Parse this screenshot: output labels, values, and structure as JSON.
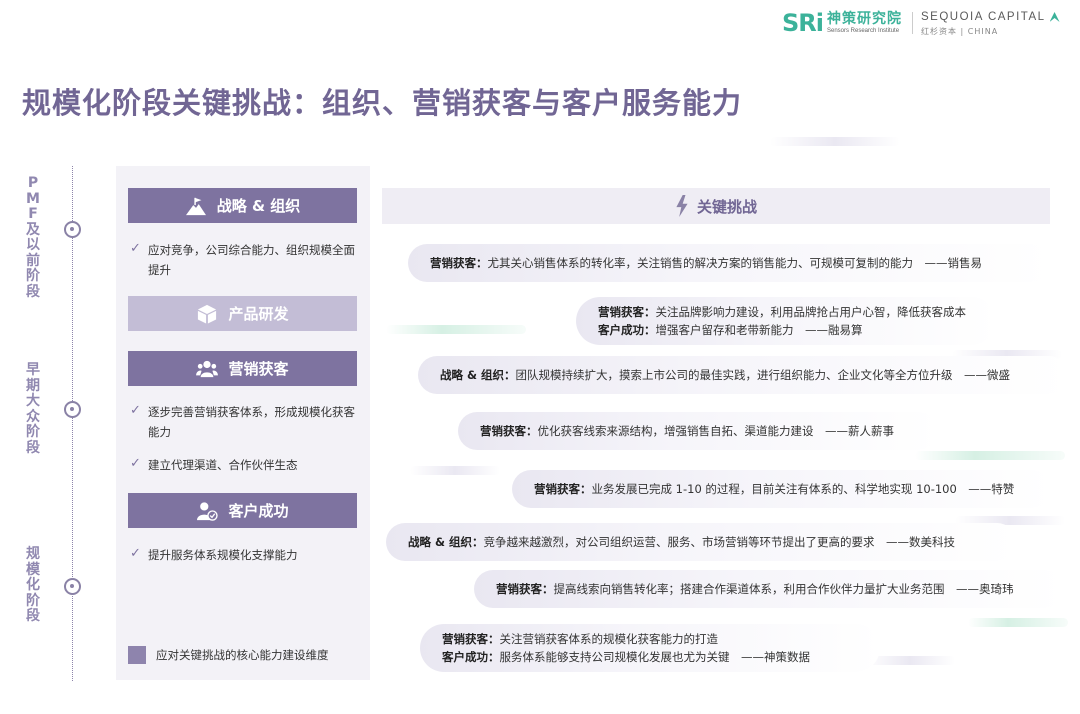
{
  "header": {
    "sri_mark": "SRi",
    "sri_name_cn": "神策研究院",
    "sri_name_en": "Sensors Research Institute",
    "sequoia_name_en": "SEQUOIA CAPITAL",
    "sequoia_name_cn": "红杉资本 | CHINA"
  },
  "title": "规模化阶段关键挑战：组织、营销获客与客户服务能力",
  "timeline": {
    "stages": [
      {
        "label": "PMF及以前阶段"
      },
      {
        "label": "早期大众阶段"
      },
      {
        "label": "规模化阶段"
      }
    ]
  },
  "capabilities": {
    "categories": [
      {
        "title": "战略 & 组织",
        "icon": "flag-mountain-icon",
        "items": [
          "应对竞争，公司综合能力、组织规模全面提升"
        ]
      },
      {
        "title": "产品研发",
        "icon": "cube-icon",
        "items": []
      },
      {
        "title": "营销获客",
        "icon": "users-icon",
        "items": [
          "逐步完善营销获客体系，形成规模化获客能力",
          "建立代理渠道、合作伙伴生态"
        ]
      },
      {
        "title": "客户成功",
        "icon": "user-check-icon",
        "items": [
          "提升服务体系规模化支撑能力"
        ]
      }
    ],
    "legend": "应对关键挑战的核心能力建设维度",
    "colors": {
      "dark": "#7e73a0",
      "light": "#c3bdd6"
    }
  },
  "challenges": {
    "header": "关键挑战",
    "icon": "lightning-icon",
    "items": [
      {
        "lines": [
          {
            "tag": "营销获客：",
            "text": "尤其关心销售体系的转化率，关注销售的解决方案的销售能力、可规模可复制的能力　——销售易"
          }
        ]
      },
      {
        "lines": [
          {
            "tag": "营销获客：",
            "text": "关注品牌影响力建设，利用品牌抢占用户心智，降低获客成本"
          },
          {
            "tag": "客户成功：",
            "text": "增强客户留存和老带新能力　——融易算"
          }
        ]
      },
      {
        "lines": [
          {
            "tag": "战略 & 组织：",
            "text": "团队规模持续扩大，摸索上市公司的最佳实践，进行组织能力、企业文化等全方位升级　——微盛"
          }
        ]
      },
      {
        "lines": [
          {
            "tag": "营销获客：",
            "text": "优化获客线索来源结构，增强销售自拓、渠道能力建设　——薪人薪事"
          }
        ]
      },
      {
        "lines": [
          {
            "tag": "营销获客：",
            "text": "业务发展已完成 1-10 的过程，目前关注有体系的、科学地实现 10-100　——特赞"
          }
        ]
      },
      {
        "lines": [
          {
            "tag": "战略 & 组织：",
            "text": "竞争越来越激烈，对公司组织运营、服务、市场营销等环节提出了更高的要求　——数美科技"
          }
        ]
      },
      {
        "lines": [
          {
            "tag": "营销获客：",
            "text": "提高线索向销售转化率；搭建合作渠道体系，利用合作伙伴力量扩大业务范围　——奥琦玮"
          }
        ]
      },
      {
        "lines": [
          {
            "tag": "营销获客：",
            "text": "关注营销获客体系的规模化获客能力的打造"
          },
          {
            "tag": "客户成功：",
            "text": "服务体系能够支持公司规模化发展也尤为关键　——神策数据"
          }
        ]
      }
    ]
  }
}
